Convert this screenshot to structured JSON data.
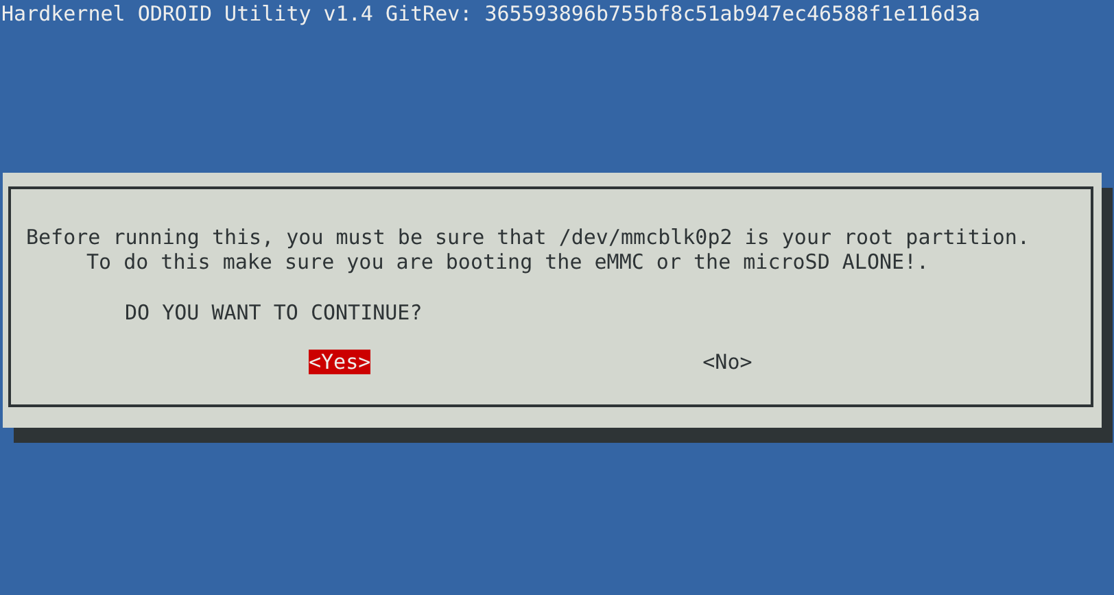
{
  "title": "Hardkernel ODROID Utility v1.4 GitRev: 365593896b755bf8c51ab947ec46588f1e116d3a",
  "dialog": {
    "message": [
      "Before running this, you must be sure that /dev/mmcblk0p2 is your root partition.",
      "To do this make sure you are booting the eMMC or the microSD ALONE!."
    ],
    "question": "DO YOU WANT TO CONTINUE?",
    "buttons": [
      {
        "label": "<Yes>",
        "selected": true
      },
      {
        "label": "<No>",
        "selected": false
      }
    ]
  }
}
